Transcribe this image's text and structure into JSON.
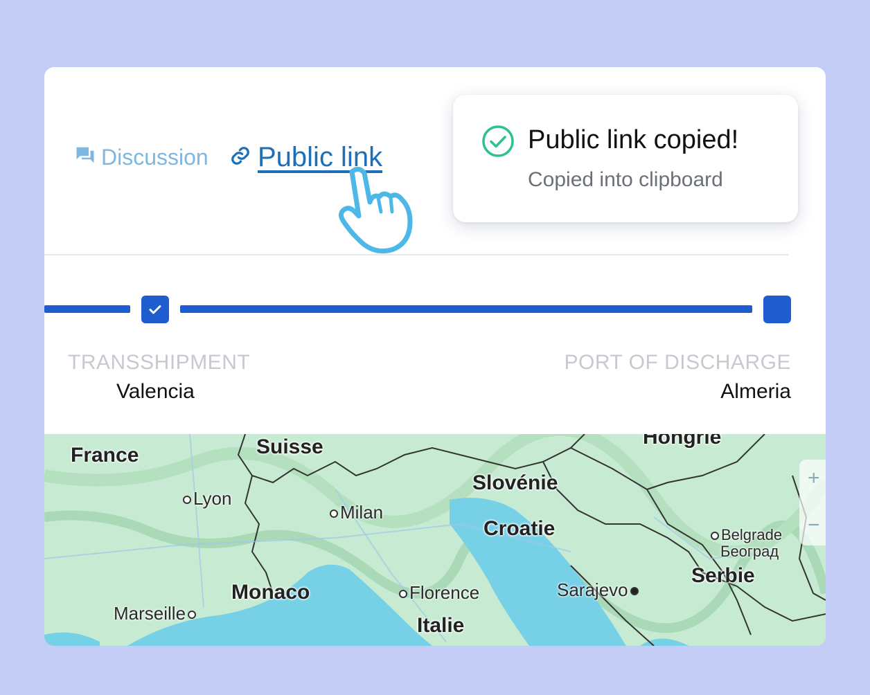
{
  "tabs": {
    "discussion": {
      "label": "Discussion",
      "icon": "chat-icon"
    },
    "public_link": {
      "label": "Public link",
      "icon": "link-icon"
    }
  },
  "toast": {
    "title": "Public link copied!",
    "subtitle": "Copied into clipboard",
    "icon": "check-circle-icon"
  },
  "route": {
    "stops": [
      {
        "label": "TRANSSHIPMENT",
        "city": "Valencia",
        "completed": true
      },
      {
        "label": "PORT OF DISCHARGE",
        "city": "Almeria",
        "completed": false
      }
    ]
  },
  "map": {
    "countries": [
      "France",
      "Suisse",
      "Hongrie",
      "Slovénie",
      "Croatie",
      "Serbie",
      "Monaco",
      "Italie"
    ],
    "cities": [
      "Lyon",
      "Milan",
      "Marseille",
      "Florence",
      "Sarajevo",
      "Belgrade",
      "Београд"
    ],
    "zoom_in": "+",
    "zoom_out": "−"
  },
  "colors": {
    "accent": "#1f5cd0",
    "link": "#1d6fb8",
    "success": "#2fc28a",
    "background": "#c4cdf6"
  }
}
